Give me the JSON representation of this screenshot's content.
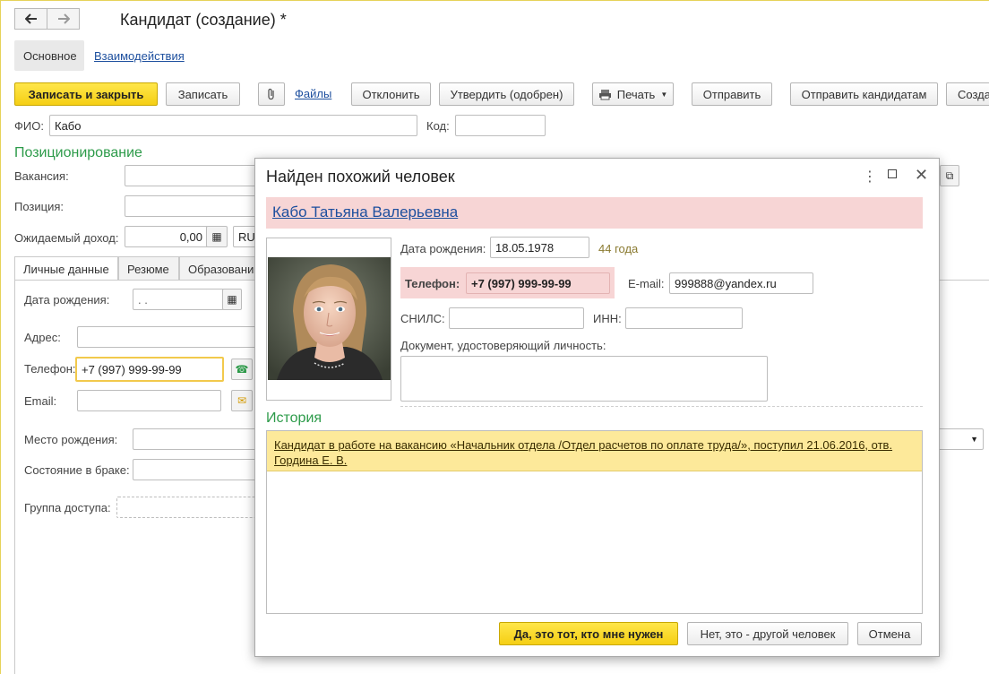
{
  "window": {
    "title": "Кандидат (создание) *"
  },
  "nav": {
    "back_icon": "arrow-left-icon",
    "forward_icon": "arrow-right-icon"
  },
  "tabs": [
    {
      "label": "Основное"
    },
    {
      "label": "Взаимодействия"
    }
  ],
  "toolbar": {
    "save_close": "Записать и закрыть",
    "save": "Записать",
    "files": "Файлы",
    "reject": "Отклонить",
    "approve": "Утвердить (одобрен)",
    "print": "Печать",
    "send": "Отправить",
    "send_candidates": "Отправить кандидатам",
    "create": "Созда"
  },
  "form": {
    "fio_label": "ФИО:",
    "fio_value": "Кабо",
    "code_label": "Код:",
    "positioning_title": "Позиционирование",
    "vacancy_label": "Вакансия:",
    "position_label": "Позиция:",
    "income_label": "Ожидаемый доход:",
    "income_value": "0,00",
    "currency_value": "RU",
    "subtabs": [
      {
        "label": "Личные данные"
      },
      {
        "label": "Резюме"
      },
      {
        "label": "Образовани"
      }
    ],
    "birth_label": "Дата рождения:",
    "birth_value": ". .",
    "address_label": "Адрес:",
    "phone_label": "Телефон:",
    "phone_value": "+7 (997) 999-99-99",
    "email_label": "Email:",
    "birthplace_label": "Место рождения:",
    "marital_label": "Состояние в браке:",
    "access_label": "Группа доступа:"
  },
  "modal": {
    "title": "Найден похожий человек",
    "name": "Кабо Татьяна Валерьевна",
    "birth_label": "Дата рождения:",
    "birth_value": "18.05.1978",
    "age": "44 года",
    "phone_label": "Телефон:",
    "phone_value": "+7 (997) 999-99-99",
    "email_label": "E-mail:",
    "email_value": "999888@yandex.ru",
    "snils_label": "СНИЛС:",
    "inn_label": "ИНН:",
    "document_label": "Документ, удостоверяющий личность:",
    "history_title": "История",
    "history_items": [
      {
        "text": "Кандидат в работе на вакансию «Начальник отдела /Отдел расчетов по оплате труда/», поступил 21.06.2016, отв. Гордина Е. В."
      }
    ],
    "btn_yes": "Да, это тот, кто мне нужен",
    "btn_no": "Нет, это - другой человек",
    "btn_cancel": "Отмена"
  },
  "colors": {
    "accent_yellow": "#f5cf14",
    "section_green": "#2d9b4a",
    "highlight_pink": "#f7d5d5",
    "link_blue": "#1d4f9e"
  }
}
